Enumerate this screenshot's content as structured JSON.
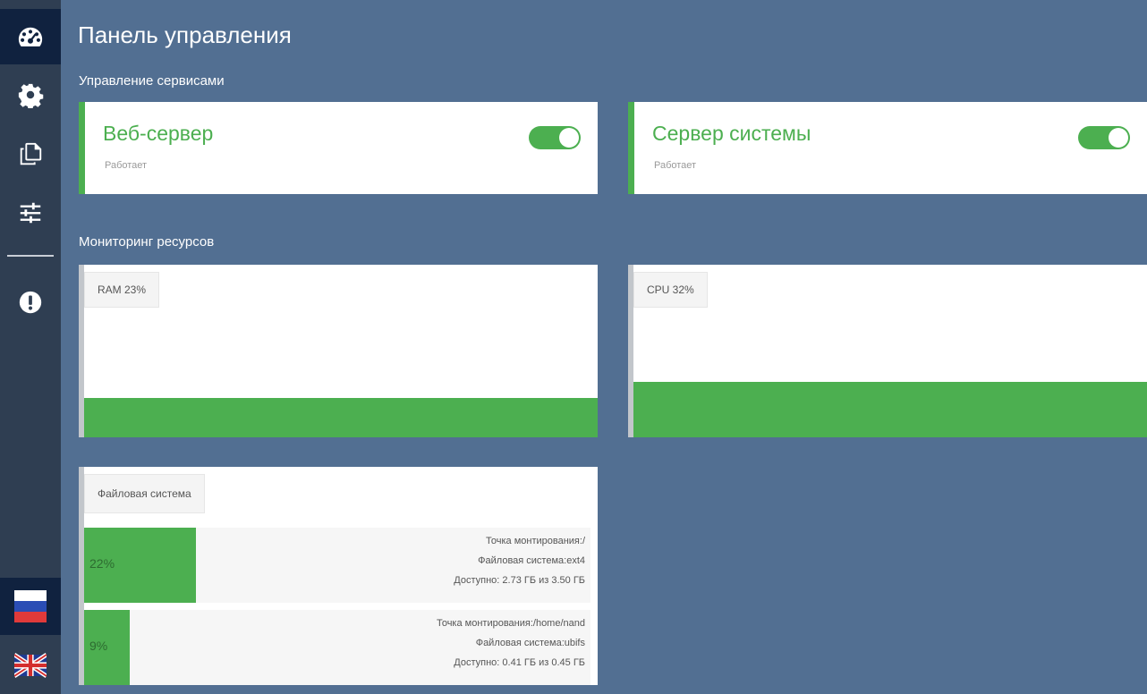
{
  "page": {
    "title": "Панель управления"
  },
  "sections": {
    "services": "Управление сервисами",
    "monitoring": "Мониторинг ресурсов"
  },
  "services": [
    {
      "name": "Веб-сервер",
      "status": "Работает",
      "enabled": true
    },
    {
      "name": "Сервер системы",
      "status": "Работает",
      "enabled": true
    }
  ],
  "resources": {
    "ram": {
      "label": "RAM 23%",
      "fraction": 0.23
    },
    "cpu": {
      "label": "CPU 32%",
      "fraction": 0.32
    }
  },
  "filesystem": {
    "title": "Файловая система",
    "mounts": [
      {
        "percent_label": "22%",
        "fraction": 0.22,
        "mount": "Точка монтирования:/",
        "fs": "Файловая система:ext4",
        "available": "Доступно: 2.73 ГБ из 3.50 ГБ"
      },
      {
        "percent_label": "9%",
        "fraction": 0.09,
        "mount": "Точка монтирования:/home/nand",
        "fs": "Файловая система:ubifs",
        "available": "Доступно: 0.41 ГБ из 0.45 ГБ"
      }
    ]
  },
  "sidebar": {
    "items": [
      {
        "icon": "dashboard-icon"
      },
      {
        "icon": "gear-icon"
      },
      {
        "icon": "copy-icon"
      },
      {
        "icon": "sliders-icon"
      },
      {
        "icon": "alert-icon"
      }
    ],
    "languages": [
      "flag-ru",
      "flag-uk"
    ]
  },
  "colors": {
    "background": "#526f92",
    "sidebar": "#2f3e52",
    "accent": "#4caf50"
  }
}
